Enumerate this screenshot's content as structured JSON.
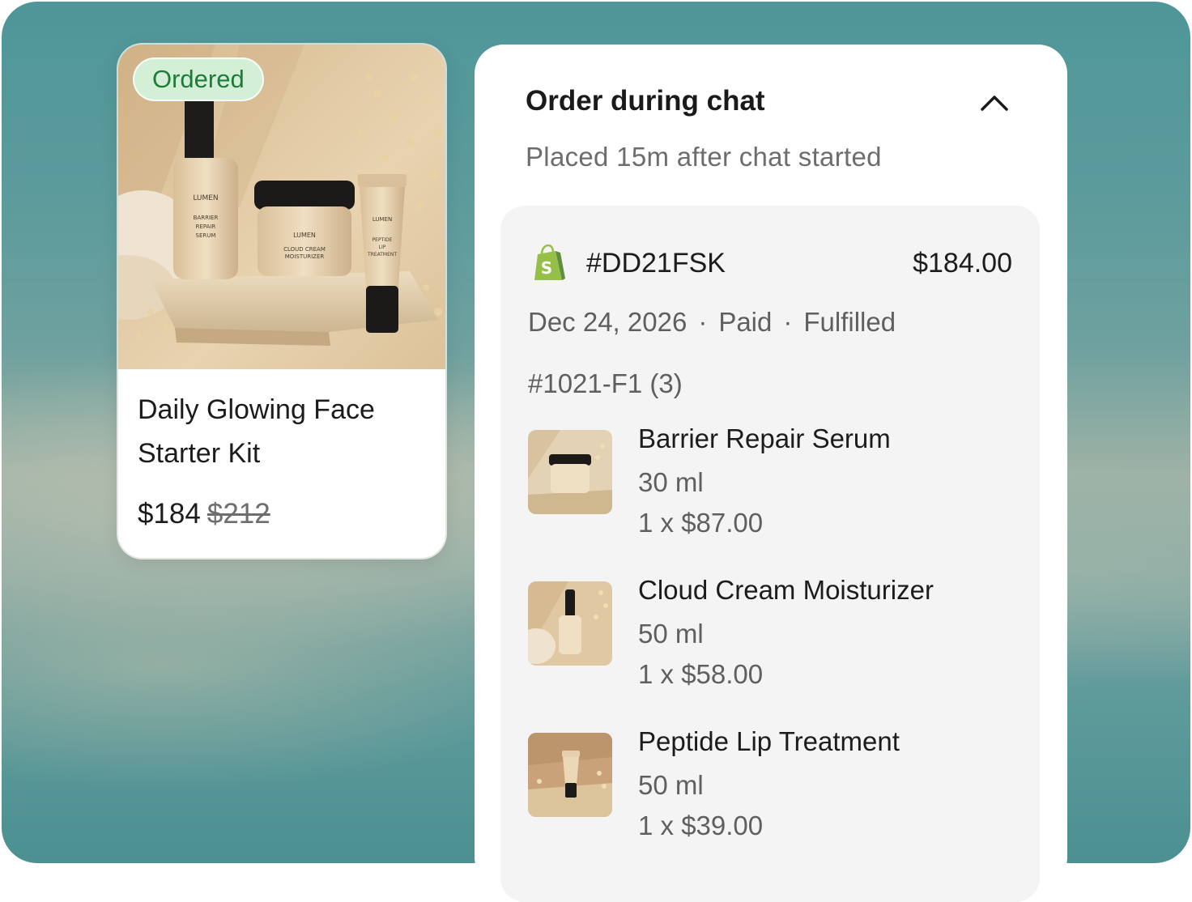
{
  "product_card": {
    "badge": "Ordered",
    "title": "Daily Glowing Face Starter Kit",
    "price": "$184",
    "original_price": "$212",
    "photo_labels": {
      "brand": "LUMEN",
      "serum": [
        "BARRIER",
        "REPAIR",
        "SERUM"
      ],
      "cream": [
        "CLOUD CREAM",
        "MOISTURIZER"
      ],
      "lip": [
        "PEPTIDE",
        "LIP",
        "TREATMENT"
      ]
    }
  },
  "order": {
    "heading": "Order during chat",
    "subtitle": "Placed 15m after chat started",
    "toggle_icon": "chevron-up-icon",
    "store_icon": "shopify-icon",
    "id": "#DD21FSK",
    "total": "$184.00",
    "date": "Dec 24, 2026",
    "payment_status": "Paid",
    "fulfillment_status": "Fulfilled",
    "separator": "·",
    "fulfillment_id": "#1021-F1 (3)",
    "items": [
      {
        "name": "Barrier Repair Serum",
        "variant": "30 ml",
        "qty_price": "1 x $87.00",
        "thumb": "jar"
      },
      {
        "name": "Cloud Cream Moisturizer",
        "variant": "50 ml",
        "qty_price": "1 x $58.00",
        "thumb": "dropper"
      },
      {
        "name": "Peptide Lip Treatment",
        "variant": "50 ml",
        "qty_price": "1 x $39.00",
        "thumb": "tube"
      }
    ]
  },
  "colors": {
    "badge_bg": "#d3f0d6",
    "badge_text": "#1e7b39",
    "shopify_green": "#95bf47",
    "shopify_dark": "#5e8e3e",
    "background_teal": "#5c9b9c"
  }
}
